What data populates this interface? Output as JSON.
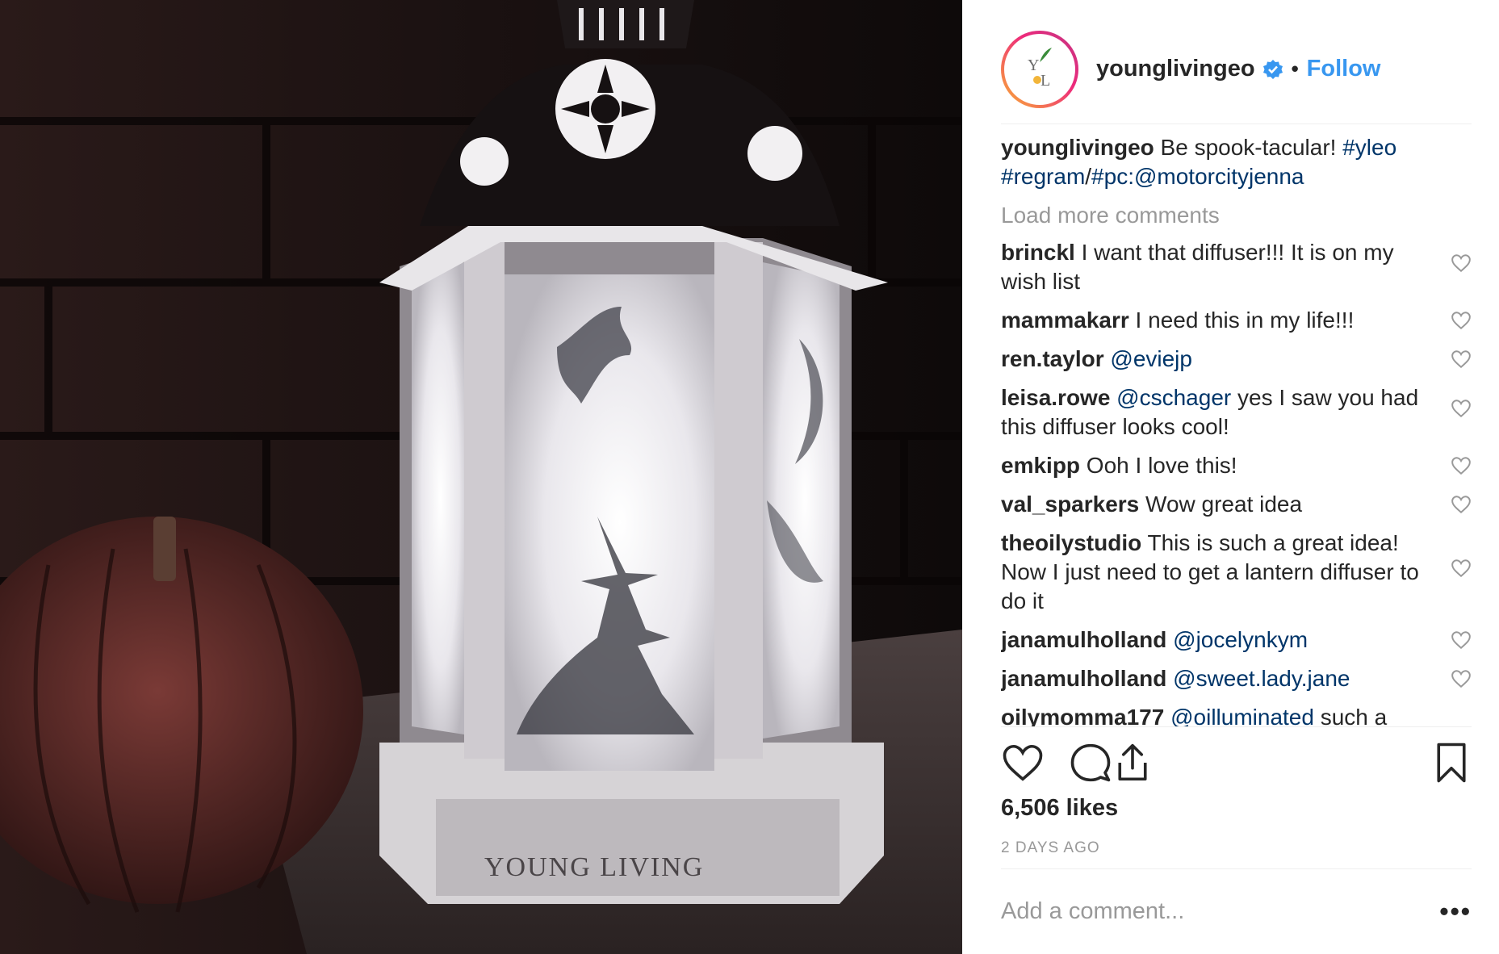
{
  "post": {
    "image_watermark": "YOUNG LIVING",
    "header": {
      "username": "younglivingeo",
      "separator": "•",
      "follow_label": "Follow",
      "avatar_text_top": "Y",
      "avatar_text_bottom": "L"
    },
    "caption": {
      "username": "younglivingeo",
      "text": " Be spook-tacular! ",
      "tag1": "#yleo",
      "tag2": "#regram",
      "slash": "/",
      "tag3": "#pc:@motorcityjenna"
    },
    "load_more": "Load more comments",
    "comments": [
      {
        "user": "brinckl",
        "mention": "",
        "text": " I want that diffuser!!! It is on my wish list"
      },
      {
        "user": "mammakarr",
        "mention": "",
        "text": " I need this in my life!!!"
      },
      {
        "user": "ren.taylor",
        "mention": " @eviejp",
        "text": ""
      },
      {
        "user": "leisa.rowe",
        "mention": " @cschager",
        "text": " yes I saw you had this diffuser looks cool!"
      },
      {
        "user": "emkipp",
        "mention": "",
        "text": " Ooh I love this!"
      },
      {
        "user": "val_sparkers",
        "mention": "",
        "text": " Wow great idea"
      },
      {
        "user": "theoilystudio",
        "mention": "",
        "text": " This is such a great idea! Now I just need to get a lantern diffuser to do it"
      },
      {
        "user": "janamulholland",
        "mention": " @jocelynkym",
        "text": ""
      },
      {
        "user": "janamulholland",
        "mention": " @sweet.lady.jane",
        "text": ""
      },
      {
        "user": "oilymomma177",
        "mention": " @oilluminated",
        "text": " such a"
      }
    ],
    "likes": "6,506 likes",
    "age": "2 DAYS AGO",
    "add_comment_placeholder": "Add a comment...",
    "more_label": "•••",
    "icons": {
      "like": "heart-icon",
      "comment": "comment-bubble-icon",
      "share": "share-upload-icon",
      "save": "bookmark-icon",
      "verified": "verified-badge-icon"
    },
    "colors": {
      "link": "#3897f0",
      "mention": "#003569",
      "muted": "#999999",
      "text": "#262626"
    }
  }
}
